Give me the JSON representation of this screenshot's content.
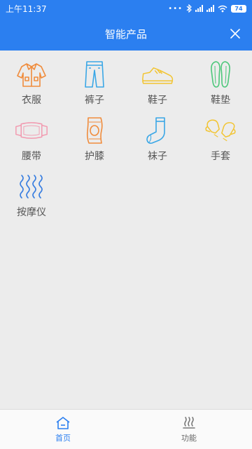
{
  "status_bar": {
    "time": "上午11:37",
    "battery": "74"
  },
  "header": {
    "title": "智能产品"
  },
  "products": [
    {
      "label": "衣服",
      "icon": "jacket-icon",
      "color": "#f08c3c"
    },
    {
      "label": "裤子",
      "icon": "pants-icon",
      "color": "#3aa7e6"
    },
    {
      "label": "鞋子",
      "icon": "sneaker-icon",
      "color": "#f2c430"
    },
    {
      "label": "鞋垫",
      "icon": "insole-icon",
      "color": "#4cc77a"
    },
    {
      "label": "腰带",
      "icon": "waist-belt-icon",
      "color": "#f29ab0"
    },
    {
      "label": "护膝",
      "icon": "knee-pad-icon",
      "color": "#f08c3c"
    },
    {
      "label": "袜子",
      "icon": "sock-icon",
      "color": "#3aa7e6"
    },
    {
      "label": "手套",
      "icon": "gloves-icon",
      "color": "#f2c430"
    },
    {
      "label": "按摩仪",
      "icon": "massager-icon",
      "color": "#3a7fe0"
    }
  ],
  "tabs": [
    {
      "label": "首页",
      "icon": "home-icon",
      "active": true
    },
    {
      "label": "功能",
      "icon": "heat-icon",
      "active": false
    }
  ],
  "colors": {
    "primary": "#2b7ff0",
    "background": "#ececec"
  }
}
